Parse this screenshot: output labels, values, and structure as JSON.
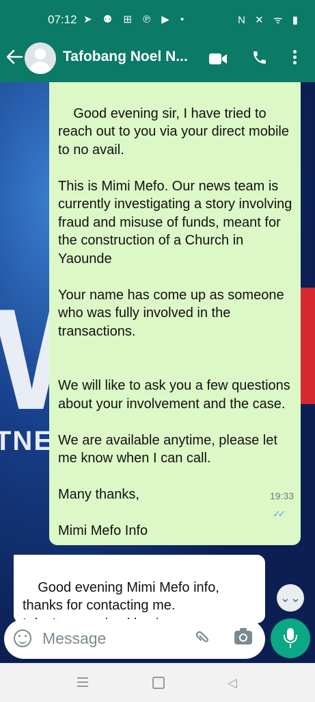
{
  "status_bar": {
    "time": "07:12",
    "left_icons": "➤ ⚉ ⊞ ℗ ▶ •",
    "right_icons": "N ✕ ᯤ ▮"
  },
  "header": {
    "contact_name": "Tafobang Noel N...",
    "icons": [
      "back-arrow-icon",
      "avatar",
      "video-call-icon",
      "phone-icon",
      "more-menu-icon"
    ]
  },
  "messages": [
    {
      "direction": "outgoing",
      "text": "Good evening sir, I have tried to reach out to you via your direct mobile to no avail.\n\nThis is Mimi Mefo. Our news team is currently investigating a story involving fraud and misuse of funds, meant for the construction of a Church in Yaounde\n\nYour name has come up as someone who was fully involved in the transactions.\n\n\nWe will like to ask you a few questions about your involvement and the case.\n\nWe are available anytime, please let me know when I can call.\n\nMany thanks,\n\nMimi Mefo Info",
      "time": "19:33",
      "read_ticks": "✓✓"
    },
    {
      "direction": "incoming",
      "text": "Good evening Mimi Mefo info,\nthanks for contacting me.\nI don't recognized having any"
    }
  ],
  "composer": {
    "placeholder": "Message",
    "icons": [
      "emoji-icon",
      "attach-icon",
      "camera-icon",
      "mic-icon"
    ]
  },
  "scroll_down_glyph": "⌄⌄",
  "navigation": {
    "back_glyph": "◁"
  },
  "colors": {
    "header": "#0b7a66",
    "outgoing_bubble": "#dcf8c6",
    "incoming_bubble": "#ffffff",
    "mic_button": "#0aa884",
    "read_ticks": "#4fb6ec"
  }
}
